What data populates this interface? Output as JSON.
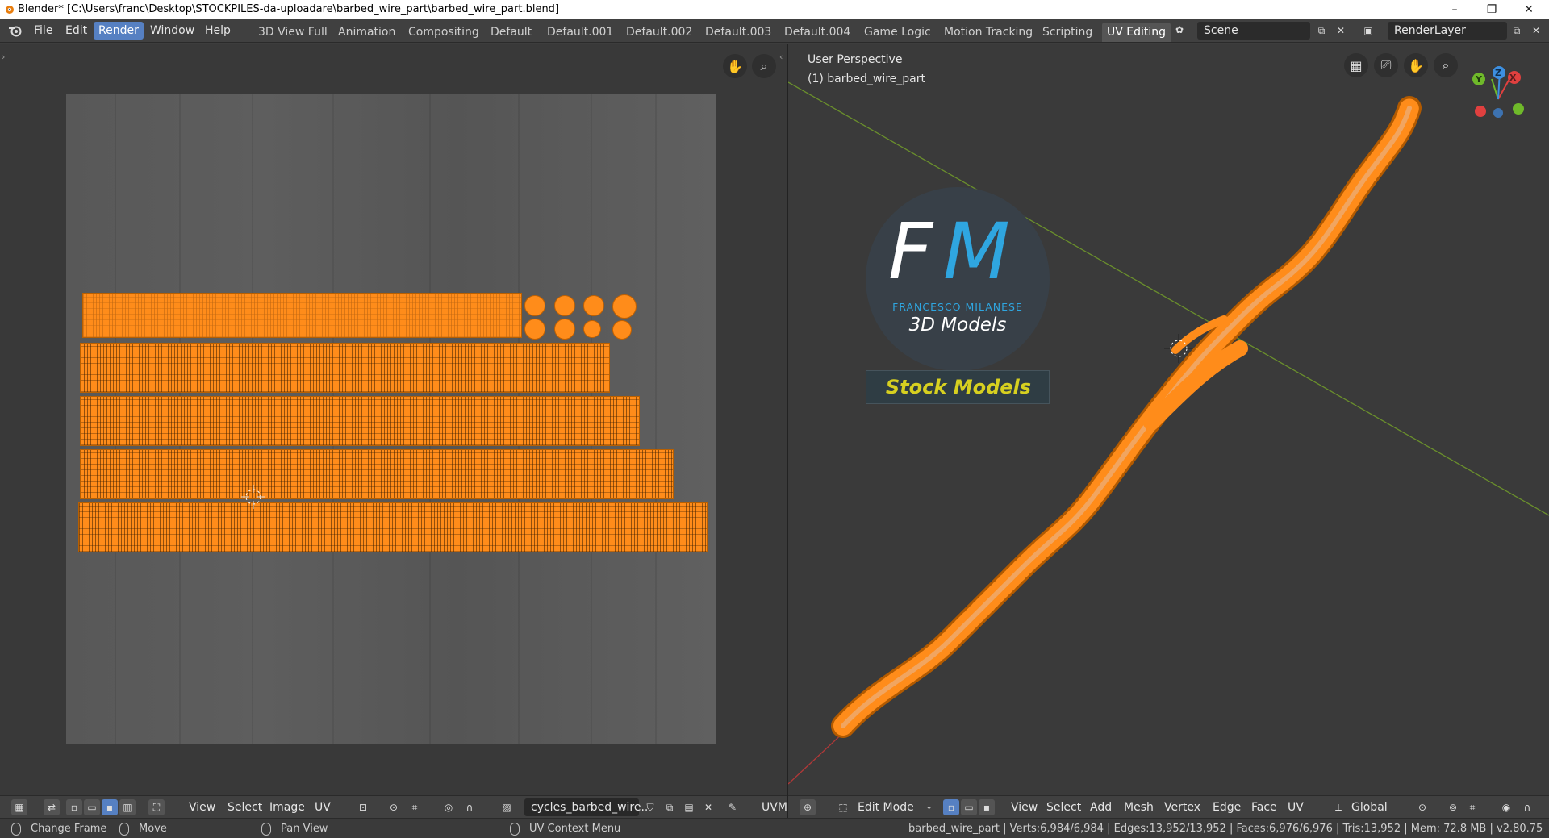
{
  "window": {
    "title": "Blender* [C:\\Users\\franc\\Desktop\\STOCKPILES-da-uploadare\\barbed_wire_part\\barbed_wire_part.blend]",
    "controls": {
      "minimize": "–",
      "maximize": "❐",
      "close": "✕"
    }
  },
  "menubar": {
    "menus": [
      "File",
      "Edit",
      "Render",
      "Window",
      "Help"
    ],
    "active_menu": "Render",
    "workspaces": [
      "3D View Full",
      "Animation",
      "Compositing",
      "Default",
      "Default.001",
      "Default.002",
      "Default.003",
      "Default.004",
      "Game Logic",
      "Motion Tracking",
      "Scripting",
      "UV Editing"
    ],
    "active_workspace": "UV Editing",
    "scene_name": "Scene",
    "render_layer": "RenderLayer"
  },
  "uv_editor": {
    "header_menus": [
      "View",
      "Select",
      "Image",
      "UV"
    ],
    "image_name": "cycles_barbed_wire..",
    "uv_map": "UVM"
  },
  "viewport": {
    "perspective": "User Perspective",
    "object_label": "(1) barbed_wire_part",
    "mode": "Edit Mode",
    "header_menus": [
      "View",
      "Select",
      "Add",
      "Mesh",
      "Vertex",
      "Edge",
      "Face",
      "UV"
    ],
    "orientation": "Global",
    "axes": {
      "x": "X",
      "y": "Y",
      "z": "Z"
    }
  },
  "watermark": {
    "monogram_f": "F",
    "monogram_m": "M",
    "author": "FRANCESCO MILANESE",
    "subtitle": "3D Models",
    "badge": "Stock Models"
  },
  "statusbar": {
    "hint_1": "Change Frame",
    "hint_2": "Move",
    "hint_3": "Pan View",
    "hint_4": "UV Context Menu",
    "stats": "barbed_wire_part | Verts:6,984/6,984 | Edges:13,952/13,952 | Faces:6,976/6,976 | Tris:13,952 | Mem: 72.8 MB | v2.80.75"
  },
  "colors": {
    "accent": "#5680c2",
    "uv_selected": "#ff8c1a",
    "background": "#3d3d3d",
    "axis_x": "#e0403f",
    "axis_y": "#6fb92a",
    "axis_z": "#3d8fe0"
  }
}
